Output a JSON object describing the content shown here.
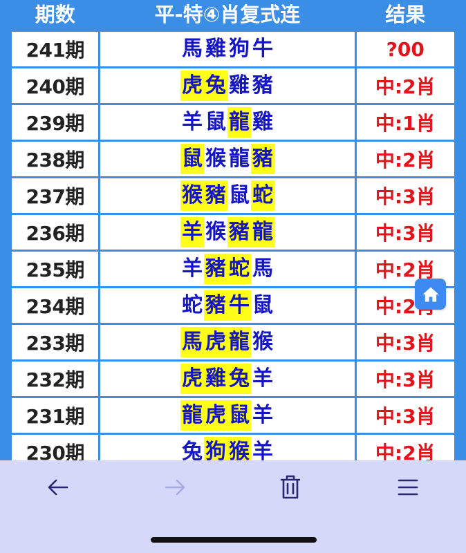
{
  "table": {
    "headers": {
      "period": "期数",
      "zodiac": "平-特④肖复式连",
      "result": "结果"
    },
    "rows": [
      {
        "period": "241期",
        "zodiac": [
          "馬",
          "雞",
          "狗",
          "牛"
        ],
        "highlight": [
          false,
          false,
          false,
          false
        ],
        "result": "?00"
      },
      {
        "period": "240期",
        "zodiac": [
          "虎",
          "兔",
          "雞",
          "豬"
        ],
        "highlight": [
          true,
          true,
          false,
          false
        ],
        "result": "中:2肖"
      },
      {
        "period": "239期",
        "zodiac": [
          "羊",
          "鼠",
          "龍",
          "雞"
        ],
        "highlight": [
          false,
          false,
          true,
          false
        ],
        "result": "中:1肖"
      },
      {
        "period": "238期",
        "zodiac": [
          "鼠",
          "猴",
          "龍",
          "豬"
        ],
        "highlight": [
          true,
          false,
          false,
          true
        ],
        "result": "中:2肖"
      },
      {
        "period": "237期",
        "zodiac": [
          "猴",
          "豬",
          "鼠",
          "蛇"
        ],
        "highlight": [
          true,
          true,
          false,
          true
        ],
        "result": "中:3肖"
      },
      {
        "period": "236期",
        "zodiac": [
          "羊",
          "猴",
          "豬",
          "龍"
        ],
        "highlight": [
          true,
          false,
          true,
          true
        ],
        "result": "中:3肖"
      },
      {
        "period": "235期",
        "zodiac": [
          "羊",
          "豬",
          "蛇",
          "馬"
        ],
        "highlight": [
          false,
          true,
          true,
          false
        ],
        "result": "中:2肖"
      },
      {
        "period": "234期",
        "zodiac": [
          "蛇",
          "豬",
          "牛",
          "鼠"
        ],
        "highlight": [
          false,
          true,
          true,
          false
        ],
        "result": "中:2肖"
      },
      {
        "period": "233期",
        "zodiac": [
          "馬",
          "虎",
          "龍",
          "猴"
        ],
        "highlight": [
          true,
          true,
          true,
          false
        ],
        "result": "中:3肖"
      },
      {
        "period": "232期",
        "zodiac": [
          "虎",
          "雞",
          "兔",
          "羊"
        ],
        "highlight": [
          true,
          true,
          true,
          false
        ],
        "result": "中:3肖"
      },
      {
        "period": "231期",
        "zodiac": [
          "龍",
          "虎",
          "鼠",
          "羊"
        ],
        "highlight": [
          true,
          true,
          true,
          false
        ],
        "result": "中:3肖"
      },
      {
        "period": "230期",
        "zodiac": [
          "兔",
          "狗",
          "猴",
          "羊"
        ],
        "highlight": [
          false,
          true,
          true,
          false
        ],
        "result": "中:2肖"
      }
    ]
  },
  "floating": {
    "home_icon": "home-icon"
  },
  "browser_toolbar": {
    "icons": [
      "back-arrow-icon",
      "forward-arrow-icon",
      "trash-icon",
      "menu-icon"
    ],
    "forward_disabled": true
  },
  "colors": {
    "border_blue": "#3a8ee6",
    "zodiac_text": "#1515c8",
    "highlight": "#ffff19",
    "result_text": "#e0141b",
    "toolbar_bg": "#d6d8f9"
  }
}
